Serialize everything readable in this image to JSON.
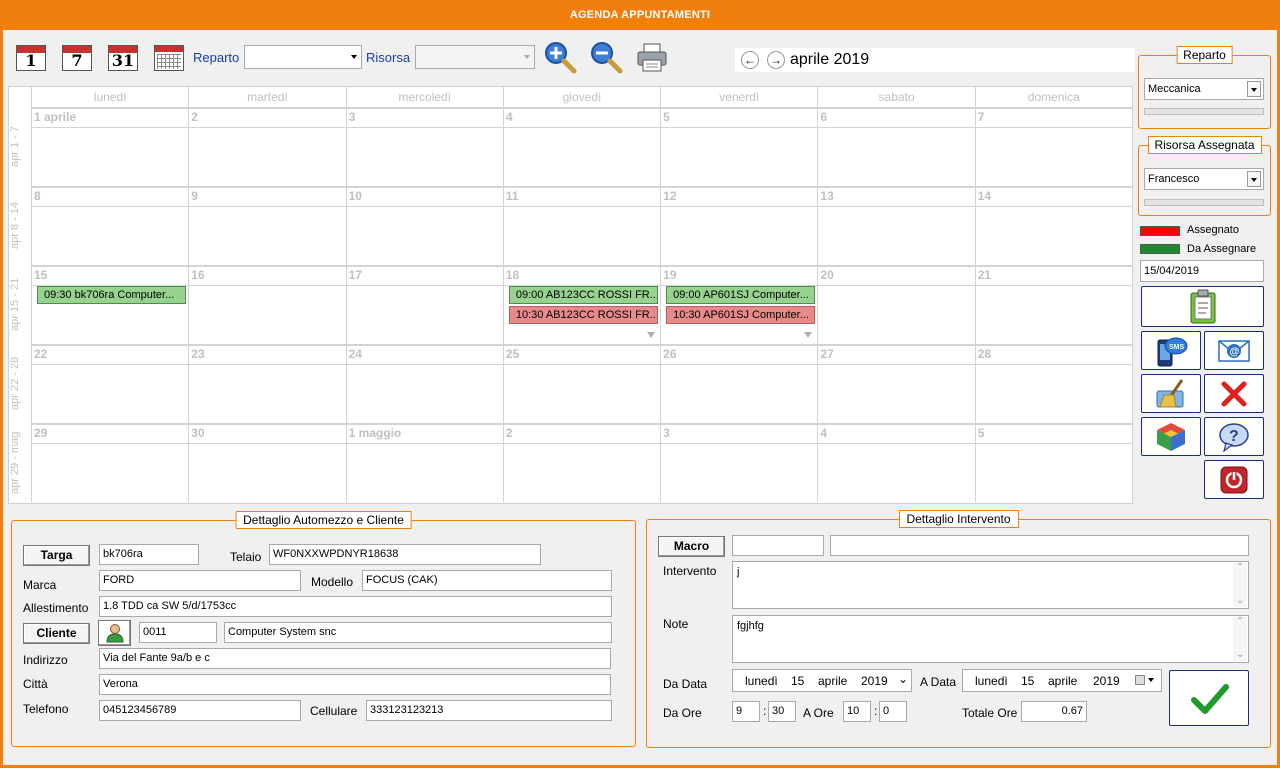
{
  "window": {
    "title": "AGENDA APPUNTAMENTI"
  },
  "toolbar": {
    "view_day_label": "1",
    "view_week_label": "7",
    "view_month_label": "31",
    "reparto_label": "Reparto",
    "reparto_value": "",
    "risorsa_label": "Risorsa",
    "risorsa_value": "",
    "month_title": "aprile 2019",
    "prev_glyph": "←",
    "next_glyph": "→"
  },
  "calendar": {
    "weekdays": [
      "lunedì",
      "martedì",
      "mercoledì",
      "giovedì",
      "venerdì",
      "sabato",
      "domenica"
    ],
    "weeks": [
      {
        "label": "apr 1 - 7",
        "days": [
          "1 aprile",
          "2",
          "3",
          "4",
          "5",
          "6",
          "7"
        ]
      },
      {
        "label": "apr 8 - 14",
        "days": [
          "8",
          "9",
          "10",
          "11",
          "12",
          "13",
          "14"
        ]
      },
      {
        "label": "apr 15 - 21",
        "days": [
          "15",
          "16",
          "17",
          "18",
          "19",
          "20",
          "21"
        ]
      },
      {
        "label": "apr 22 - 28",
        "days": [
          "22",
          "23",
          "24",
          "25",
          "26",
          "27",
          "28"
        ]
      },
      {
        "label": "apr 29 - mag",
        "days": [
          "29",
          "30",
          "1 maggio",
          "2",
          "3",
          "4",
          "5"
        ]
      }
    ],
    "appointments": [
      {
        "week": 2,
        "day": 0,
        "slot": 0,
        "text": "09:30 bk706ra Computer...",
        "status": "green"
      },
      {
        "week": 2,
        "day": 3,
        "slot": 0,
        "text": "09:00 AB123CC ROSSI FR...",
        "status": "green"
      },
      {
        "week": 2,
        "day": 3,
        "slot": 1,
        "text": "10:30 AB123CC ROSSI FR...",
        "status": "red"
      },
      {
        "week": 2,
        "day": 4,
        "slot": 0,
        "text": "09:00 AP601SJ Computer...",
        "status": "green"
      },
      {
        "week": 2,
        "day": 4,
        "slot": 1,
        "text": "10:30 AP601SJ Computer...",
        "status": "red"
      }
    ]
  },
  "side": {
    "reparto_title": "Reparto",
    "reparto_value": "Meccanica",
    "risorsa_title": "Risorsa Assegnata",
    "risorsa_value": "Francesco",
    "legend_assigned": "Assegnato",
    "legend_to_assign": "Da Assegnare",
    "color_assigned": "#ff0000",
    "color_to_assign": "#1f8a2e",
    "selected_date": "15/04/2019",
    "buttons": [
      "clipboard-icon",
      "sms-icon",
      "email-icon",
      "broom-icon",
      "delete-icon",
      "cube-icon",
      "help-icon",
      "power-icon"
    ]
  },
  "vehicle": {
    "title": "Dettaglio Automezzo e Cliente",
    "targa_btn": "Targa",
    "targa": "bk706ra",
    "telaio_label": "Telaio",
    "telaio": "WF0NXXWPDNYR18638",
    "marca_label": "Marca",
    "marca": "FORD",
    "modello_label": "Modello",
    "modello": "FOCUS (CAK)",
    "allestimento_label": "Allestimento",
    "allestimento": "1.8 TDD ca SW 5/d/1753cc",
    "cliente_btn": "Cliente",
    "cliente_code": "0011",
    "cliente_name": "Computer System snc",
    "indirizzo_label": "Indirizzo",
    "indirizzo": "Via del Fante 9a/b e c",
    "citta_label": "Città",
    "citta": "Verona",
    "telefono_label": "Telefono",
    "telefono": "045123456789",
    "cellulare_label": "Cellulare",
    "cellulare": "333123123213"
  },
  "intervento": {
    "title": "Dettaglio Intervento",
    "macro_btn": "Macro",
    "macro_code": "",
    "macro_desc": "",
    "intervento_label": "Intervento",
    "intervento": "j",
    "note_label": "Note",
    "note": "fgjhfg",
    "da_data_label": "Da Data",
    "da_data": {
      "weekday": "lunedì",
      "day": "15",
      "month": "aprile",
      "year": "2019"
    },
    "a_data_label": "A Data",
    "a_data": {
      "weekday": "lunedì",
      "day": "15",
      "month": "aprile",
      "year": "2019"
    },
    "da_ore_label": "Da Ore",
    "da_ore_h": "9",
    "da_ore_m": "30",
    "a_ore_label": "A Ore",
    "a_ore_h": "10",
    "a_ore_m": "0",
    "sep": ":",
    "totale_label": "Totale Ore",
    "totale": "0.67"
  }
}
